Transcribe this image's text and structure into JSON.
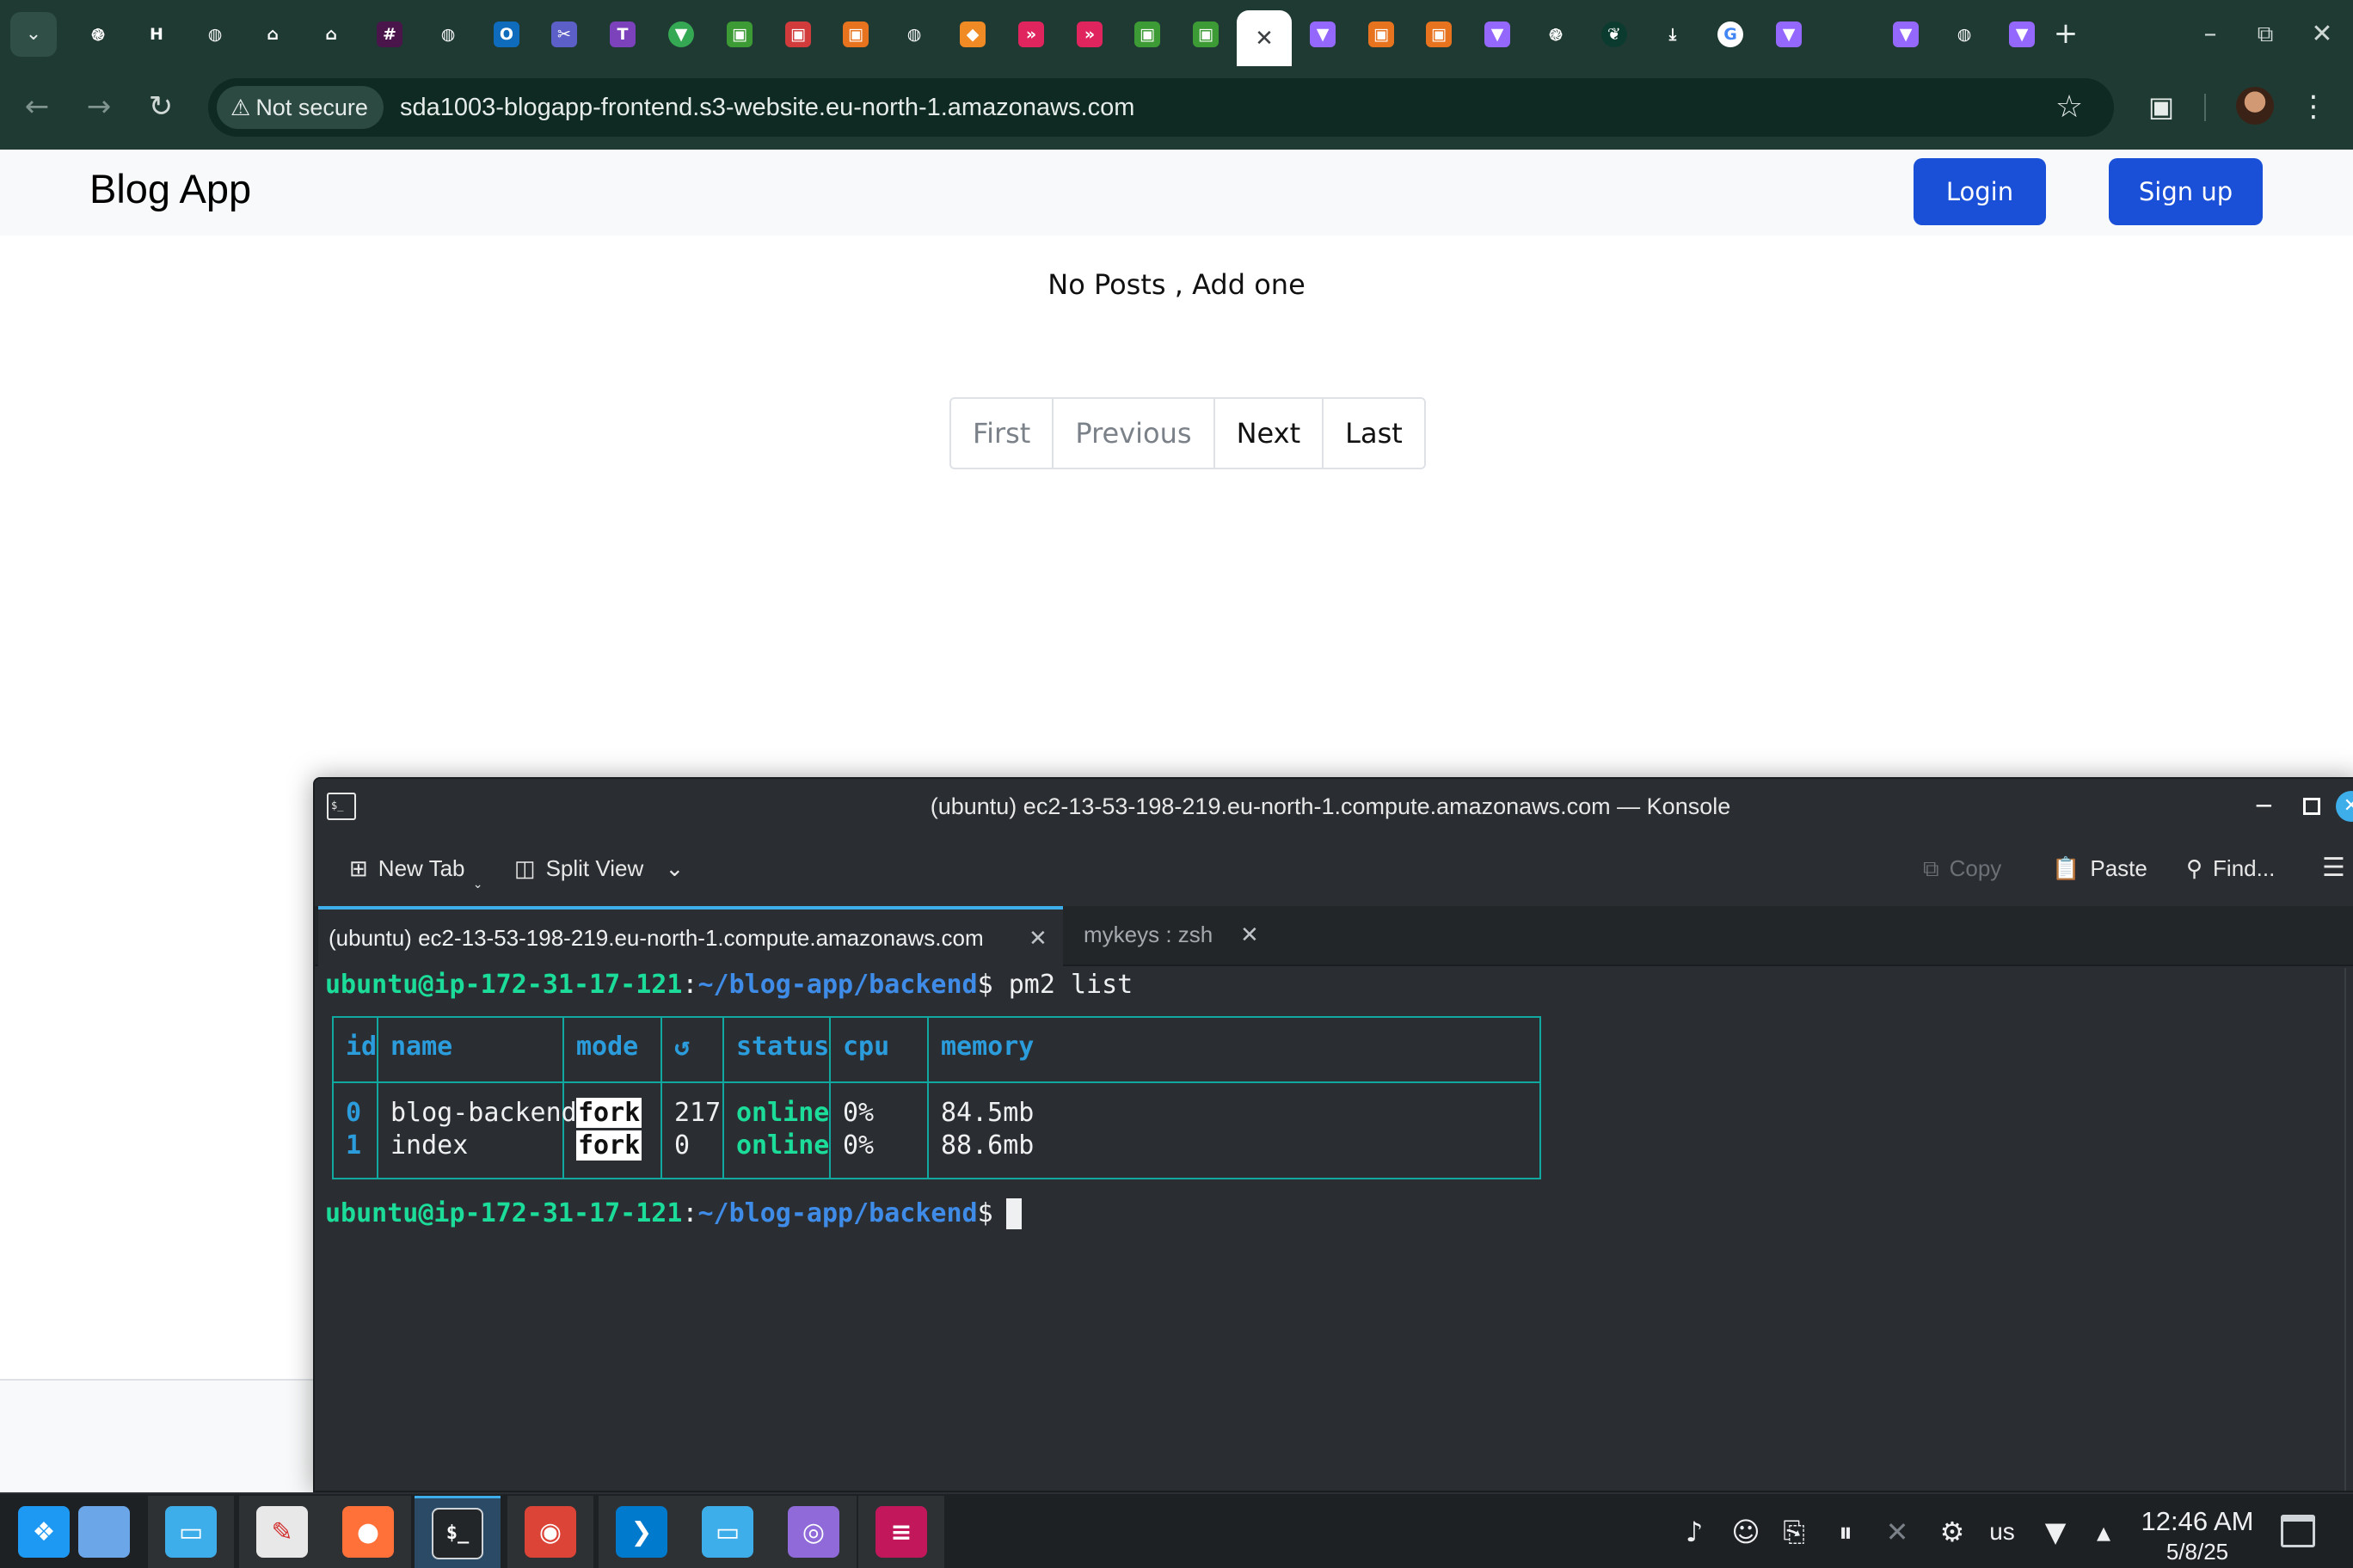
{
  "browser": {
    "tabs": [
      {
        "icon": "openai-icon",
        "glyph": "֎",
        "bg": "#1f3a33",
        "circ": true
      },
      {
        "icon": "hashicorp-icon",
        "glyph": "H",
        "bg": "#1f3a33"
      },
      {
        "icon": "globe-icon",
        "glyph": "◍",
        "bg": "#1f3a33",
        "circ": true
      },
      {
        "icon": "bank-icon",
        "glyph": "⌂",
        "bg": "#1f3a33"
      },
      {
        "icon": "bank-icon",
        "glyph": "⌂",
        "bg": "#1f3a33"
      },
      {
        "icon": "slack-icon",
        "glyph": "#",
        "bg": "#4a154b"
      },
      {
        "icon": "globe-icon",
        "glyph": "◍",
        "bg": "#1f3a33",
        "circ": true
      },
      {
        "icon": "outlook-icon",
        "glyph": "O",
        "bg": "#0f6cbd"
      },
      {
        "icon": "scissors-icon",
        "glyph": "✂",
        "bg": "#5b5fc7"
      },
      {
        "icon": "terraform-icon",
        "glyph": "T",
        "bg": "#7b42bc"
      },
      {
        "icon": "maps-pin-icon",
        "glyph": "▼",
        "bg": "#34a853",
        "circ": true
      },
      {
        "icon": "green-app-icon",
        "glyph": "▣",
        "bg": "#3d9b35"
      },
      {
        "icon": "red-app-icon",
        "glyph": "▣",
        "bg": "#d13b3b"
      },
      {
        "icon": "orange-app-icon",
        "glyph": "▣",
        "bg": "#e8731e"
      },
      {
        "icon": "globe-icon",
        "glyph": "◍",
        "bg": "#1f3a33",
        "circ": true
      },
      {
        "icon": "aws-cube-icon",
        "glyph": "◆",
        "bg": "#f08a24"
      },
      {
        "icon": "chevron-red-icon",
        "glyph": "»",
        "bg": "#e0245e"
      },
      {
        "icon": "chevron-red-icon",
        "glyph": "»",
        "bg": "#e0245e"
      },
      {
        "icon": "green-app-icon",
        "glyph": "▣",
        "bg": "#3d9b35"
      },
      {
        "icon": "green-app-icon",
        "glyph": "▣",
        "bg": "#3d9b35"
      },
      {
        "icon": "close-icon",
        "glyph": "✕",
        "bg": "transparent",
        "active": true
      },
      {
        "icon": "vite-icon",
        "glyph": "▼",
        "bg": "#9467fd"
      },
      {
        "icon": "orange-app-icon",
        "glyph": "▣",
        "bg": "#e8731e"
      },
      {
        "icon": "orange-app-icon",
        "glyph": "▣",
        "bg": "#e8731e"
      },
      {
        "icon": "vite-icon",
        "glyph": "▼",
        "bg": "#9467fd"
      },
      {
        "icon": "openai-icon",
        "glyph": "֎",
        "bg": "#1f3a33",
        "circ": true
      },
      {
        "icon": "mongodb-leaf-icon",
        "glyph": "❦",
        "bg": "#0b3b2e",
        "circ": true
      },
      {
        "icon": "download-icon",
        "glyph": "⤓",
        "bg": "#1f3a33"
      },
      {
        "icon": "google-icon",
        "glyph": "G",
        "bg": "#ffffff",
        "circ": true
      },
      {
        "icon": "vite-icon",
        "glyph": "▼",
        "bg": "#9467fd"
      },
      {
        "icon": "blank-tab-icon",
        "glyph": "",
        "bg": "#1f3a33"
      },
      {
        "icon": "vite-icon",
        "glyph": "▼",
        "bg": "#9467fd"
      },
      {
        "icon": "globe-icon",
        "glyph": "◍",
        "bg": "#1f3a33",
        "circ": true
      },
      {
        "icon": "vite-icon",
        "glyph": "▼",
        "bg": "#9467fd"
      }
    ],
    "tab_search_icon": "chevron-down-icon",
    "new_tab_glyph": "+",
    "security_label": "Not secure",
    "url": "sda1003-blogapp-frontend.s3-website.eu-north-1.amazonaws.com",
    "accent": "#1f3a33"
  },
  "page": {
    "brand": "Blog App",
    "login_label": "Login",
    "signup_label": "Sign up",
    "empty_message": "No Posts , Add one",
    "pagination": [
      {
        "label": "First",
        "enabled": false
      },
      {
        "label": "Previous",
        "enabled": false
      },
      {
        "label": "Next",
        "enabled": true
      },
      {
        "label": "Last",
        "enabled": true
      }
    ],
    "button_color": "#1a4fd8"
  },
  "konsole": {
    "title": "(ubuntu) ec2-13-53-198-219.eu-north-1.compute.amazonaws.com — Konsole",
    "toolbar": {
      "new_tab": "New Tab",
      "split_view": "Split View",
      "copy": "Copy",
      "paste": "Paste",
      "find": "Find..."
    },
    "tabs": [
      {
        "label": "(ubuntu) ec2-13-53-198-219.eu-north-1.compute.amazonaws.com"
      },
      {
        "label": "mykeys : zsh"
      }
    ],
    "prompt": {
      "user_host": "ubuntu@ip-172-31-17-121",
      "sep": ":",
      "path": "~/blog-app/backend",
      "dollar": "$"
    },
    "command": " pm2 list",
    "pm2": {
      "headers": [
        "id",
        "name",
        "mode",
        "↺",
        "status",
        "cpu",
        "memory"
      ],
      "rows": [
        {
          "id": "0",
          "name": "blog-backend",
          "mode": "fork",
          "restarts": "217",
          "status": "online",
          "cpu": "0%",
          "memory": "84.5mb"
        },
        {
          "id": "1",
          "name": "index",
          "mode": "fork",
          "restarts": "0",
          "status": "online",
          "cpu": "0%",
          "memory": "88.6mb"
        }
      ]
    }
  },
  "taskbar": {
    "apps": [
      {
        "name": "kde-launcher-icon",
        "glyph": "❖",
        "bg": "#1d99f3"
      },
      {
        "name": "desktop-pager-icon",
        "glyph": "",
        "bg": "#6aa6e8"
      },
      {
        "name": "file-manager-icon",
        "glyph": "▭",
        "bg": "#3daee9"
      },
      {
        "name": "text-editor-icon",
        "glyph": "✎",
        "bg": "#e8e8e8"
      },
      {
        "name": "firefox-icon",
        "glyph": "●",
        "bg": "#ff7139"
      },
      {
        "name": "terminal-icon",
        "glyph": "$_",
        "bg": "#232629"
      },
      {
        "name": "chrome-icon",
        "glyph": "◉",
        "bg": "#db4437"
      },
      {
        "name": "vscode-icon",
        "glyph": "❯",
        "bg": "#007acc"
      },
      {
        "name": "files-icon",
        "glyph": "▭",
        "bg": "#3daee9"
      },
      {
        "name": "image-viewer-icon",
        "glyph": "◎",
        "bg": "#8f6ad8"
      },
      {
        "name": "document-reader-icon",
        "glyph": "≡",
        "bg": "#c2185b"
      }
    ],
    "tray": [
      {
        "name": "notifications-bell-icon",
        "glyph": "♪"
      },
      {
        "name": "discord-icon",
        "glyph": "☺"
      },
      {
        "name": "clipboard-icon",
        "glyph": "⎘"
      },
      {
        "name": "pause-icon",
        "glyph": "⏸"
      },
      {
        "name": "volume-muted-icon",
        "glyph": "✕"
      },
      {
        "name": "settings-icon",
        "glyph": "⚙"
      },
      {
        "name": "keyboard-layout",
        "glyph": "us"
      },
      {
        "name": "wifi-icon",
        "glyph": "▼"
      },
      {
        "name": "expand-tray-icon",
        "glyph": "▴"
      }
    ],
    "time": "12:46 AM",
    "date": "5/8/25"
  }
}
